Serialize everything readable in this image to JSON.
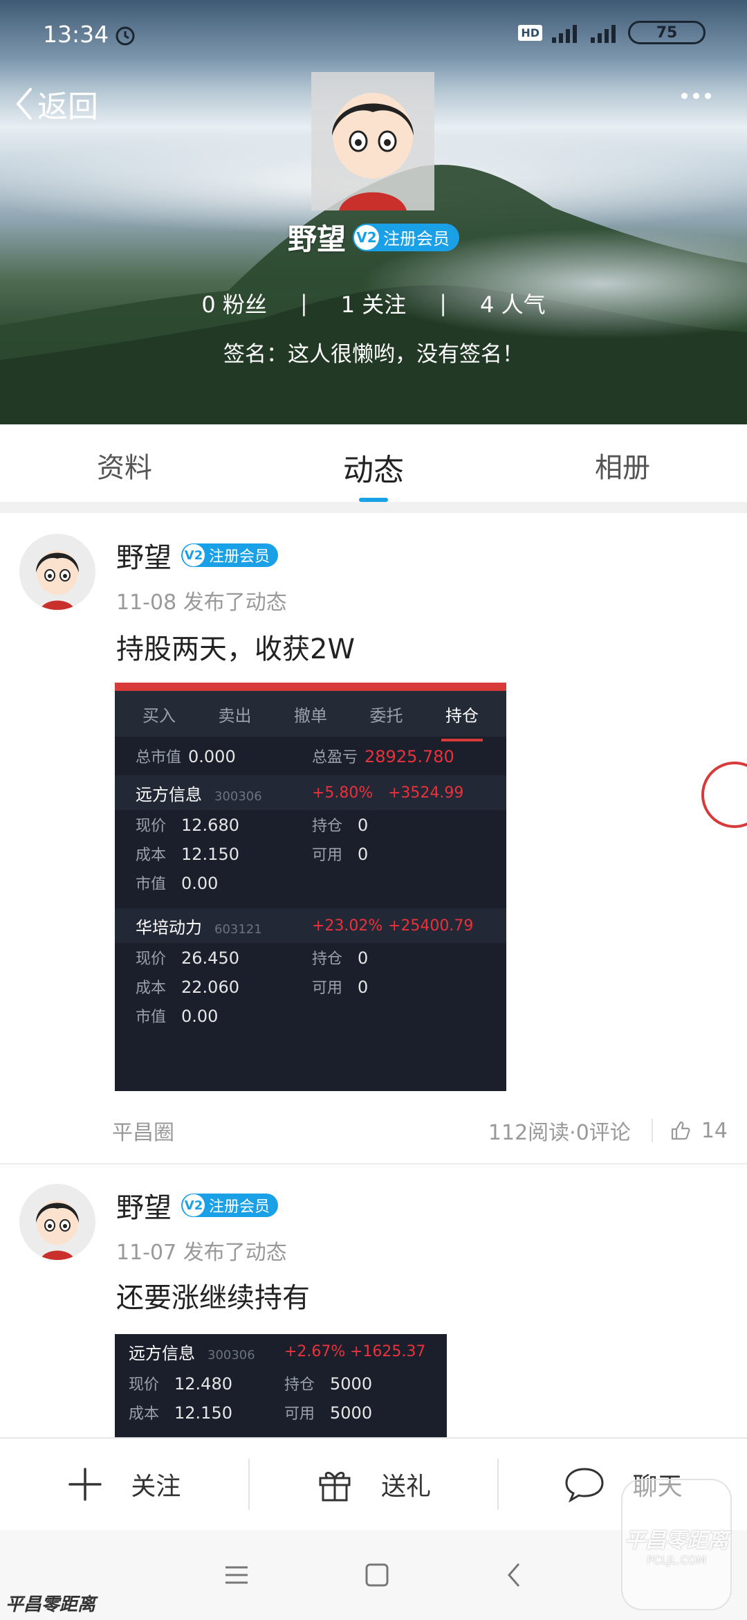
{
  "status_bar": {
    "time": "13:34",
    "hd": "HD",
    "network": "4G",
    "battery": "75"
  },
  "header": {
    "back_label": "返回",
    "profile_name": "野望",
    "badge_label": "注册会员",
    "badge_v": "V2",
    "stats": {
      "fans": "0 粉丝",
      "following": "1 关注",
      "popularity": "4 人气"
    },
    "signature": "签名：这人很懒哟，没有签名！"
  },
  "tabs": [
    {
      "label": "资料",
      "active": false
    },
    {
      "label": "动态",
      "active": true
    },
    {
      "label": "相册",
      "active": false
    }
  ],
  "posts": [
    {
      "author": "野望",
      "badge": "注册会员",
      "date": "11-08",
      "action": "发布了动态",
      "content": "持股两天，收获2W",
      "circle": "平昌圈",
      "reads": "112阅读·0评论",
      "likes": "14",
      "image": {
        "tabs": [
          "买入",
          "卖出",
          "撤单",
          "委托",
          "持仓"
        ],
        "active_tab": "持仓",
        "total_value_label": "总市值",
        "total_value": "0.000",
        "total_pl_label": "总盈亏",
        "total_pl": "28925.780",
        "stocks": [
          {
            "name": "远方信息",
            "code": "300306",
            "pct": "+5.80%",
            "pl": "+3524.99",
            "price_label": "现价",
            "price": "12.680",
            "hold_label": "持仓",
            "hold": "0",
            "cost_label": "成本",
            "cost": "12.150",
            "avail_label": "可用",
            "avail": "0",
            "mv_label": "市值",
            "mv": "0.00"
          },
          {
            "name": "华培动力",
            "code": "603121",
            "pct": "+23.02%",
            "pl": "+25400.79",
            "price_label": "现价",
            "price": "26.450",
            "hold_label": "持仓",
            "hold": "0",
            "cost_label": "成本",
            "cost": "22.060",
            "avail_label": "可用",
            "avail": "0",
            "mv_label": "市值",
            "mv": "0.00"
          }
        ]
      }
    },
    {
      "author": "野望",
      "badge": "注册会员",
      "date": "11-07",
      "action": "发布了动态",
      "content": "还要涨继续持有",
      "image": {
        "stocks": [
          {
            "name": "远方信息",
            "code": "300306",
            "pct": "+2.67%",
            "pl": "+1625.37",
            "price_label": "现价",
            "price": "12.480",
            "hold_label": "持仓",
            "hold": "5000",
            "cost_label": "成本",
            "cost": "12.150",
            "avail_label": "可用",
            "avail": "5000"
          }
        ]
      }
    }
  ],
  "action_bar": {
    "follow": "关注",
    "gift": "送礼",
    "chat": "聊天"
  },
  "watermark": {
    "text": "平昌零距离",
    "logo_text": "平昌零距离",
    "logo_sub": "PCLJL.COM"
  },
  "colors": {
    "accent": "#1aa0e6",
    "stock_red": "#e8323c",
    "stock_bg": "#1b1f2b"
  }
}
